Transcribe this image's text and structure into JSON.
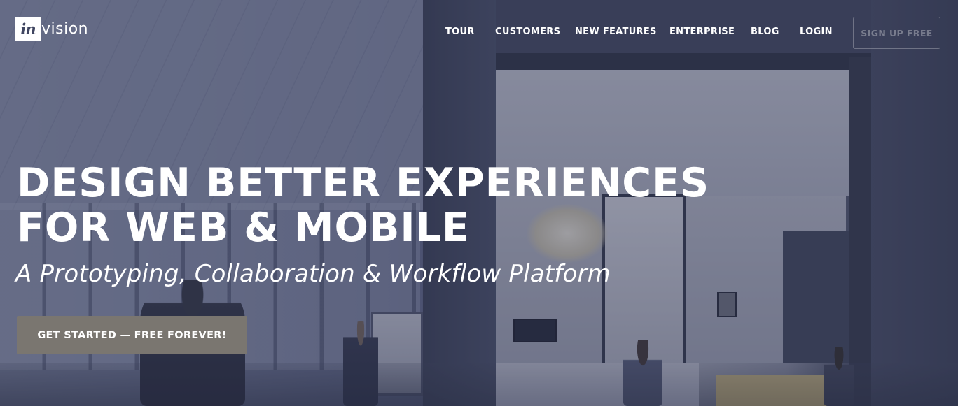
{
  "brand": {
    "logo_mark": "in",
    "logo_rest": "vision"
  },
  "nav": {
    "items": [
      {
        "label": "TOUR"
      },
      {
        "label": "CUSTOMERS"
      },
      {
        "label": "NEW FEATURES"
      },
      {
        "label": "ENTERPRISE"
      },
      {
        "label": "BLOG"
      },
      {
        "label": "LOGIN"
      }
    ],
    "signup_label": "SIGN UP FREE"
  },
  "hero": {
    "title_line_1": "DESIGN BETTER EXPERIENCES",
    "title_line_2": "FOR WEB & MOBILE",
    "subtitle": "A Prototyping, Collaboration & Workflow Platform",
    "cta_label": "GET STARTED — FREE FOREVER!",
    "background_image": "office-interior-photo"
  },
  "colors": {
    "overlay": "#343a58",
    "cta_background": "#7a7670",
    "text": "#ffffff"
  }
}
